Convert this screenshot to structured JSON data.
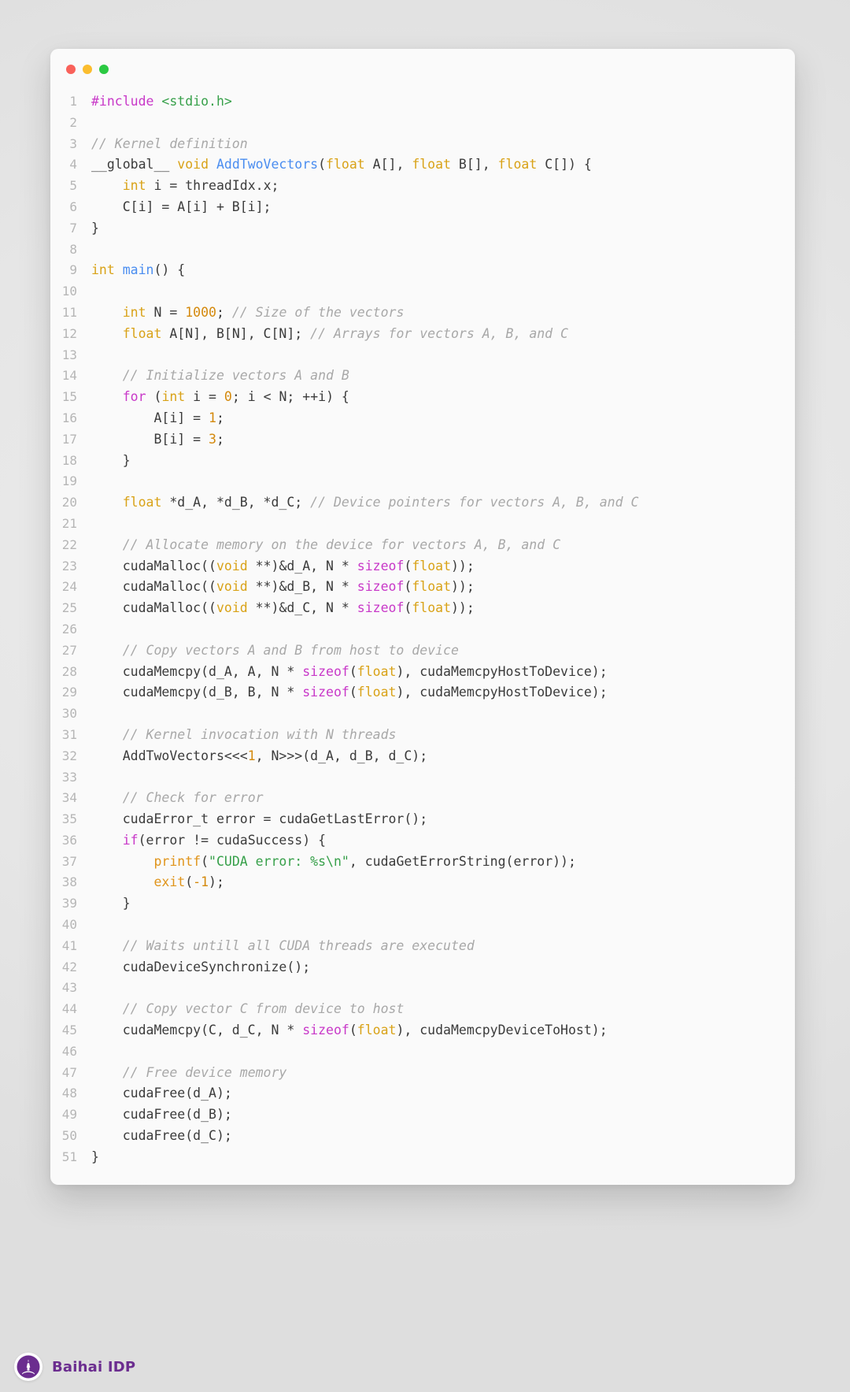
{
  "window": {
    "traffic_lights": [
      {
        "name": "close",
        "color": "#f9615a"
      },
      {
        "name": "minimize",
        "color": "#fbbd2e"
      },
      {
        "name": "maximize",
        "color": "#2bc942"
      }
    ]
  },
  "footer": {
    "brand_name": "Baihai IDP",
    "brand_color": "#6b2d8f",
    "logo_icon": "lighthouse-icon"
  },
  "theme": {
    "background": "#e6e6e6",
    "card_background": "#fafafa",
    "line_number_color": "#b6b6b6",
    "text_color": "#3b3b3b",
    "comment_color": "#a8a8a8",
    "keyword_color": "#d9a217",
    "control_keyword_color": "#c838c8",
    "function_color": "#4a8df0",
    "call_color": "#e0941a",
    "string_color": "#37a04a",
    "number_color": "#d4890c"
  },
  "code": {
    "language": "cuda-c",
    "total_lines": 51,
    "lines": [
      {
        "n": "1",
        "tokens": [
          {
            "t": "#include ",
            "c": "pre"
          },
          {
            "t": "<stdio.h>",
            "c": "str"
          }
        ]
      },
      {
        "n": "2",
        "tokens": []
      },
      {
        "n": "3",
        "tokens": [
          {
            "t": "// Kernel definition",
            "c": "cmt"
          }
        ]
      },
      {
        "n": "4",
        "tokens": [
          {
            "t": "__global__ ",
            "c": "plain"
          },
          {
            "t": "void ",
            "c": "kw"
          },
          {
            "t": "AddTwoVectors",
            "c": "fn"
          },
          {
            "t": "(",
            "c": "plain"
          },
          {
            "t": "float",
            "c": "kw"
          },
          {
            "t": " A[], ",
            "c": "plain"
          },
          {
            "t": "float",
            "c": "kw"
          },
          {
            "t": " B[], ",
            "c": "plain"
          },
          {
            "t": "float",
            "c": "kw"
          },
          {
            "t": " C[]) {",
            "c": "plain"
          }
        ]
      },
      {
        "n": "5",
        "tokens": [
          {
            "t": "    ",
            "c": "plain"
          },
          {
            "t": "int",
            "c": "kw"
          },
          {
            "t": " i = threadIdx.x;",
            "c": "plain"
          }
        ]
      },
      {
        "n": "6",
        "tokens": [
          {
            "t": "    C[i] = A[i] + B[i];",
            "c": "plain"
          }
        ]
      },
      {
        "n": "7",
        "tokens": [
          {
            "t": "}",
            "c": "plain"
          }
        ]
      },
      {
        "n": "8",
        "tokens": []
      },
      {
        "n": "9",
        "tokens": [
          {
            "t": "int ",
            "c": "kw"
          },
          {
            "t": "main",
            "c": "fn"
          },
          {
            "t": "() {",
            "c": "plain"
          }
        ]
      },
      {
        "n": "10",
        "tokens": []
      },
      {
        "n": "11",
        "tokens": [
          {
            "t": "    ",
            "c": "plain"
          },
          {
            "t": "int",
            "c": "kw"
          },
          {
            "t": " N = ",
            "c": "plain"
          },
          {
            "t": "1000",
            "c": "num"
          },
          {
            "t": "; ",
            "c": "plain"
          },
          {
            "t": "// Size of the vectors",
            "c": "cmt"
          }
        ]
      },
      {
        "n": "12",
        "tokens": [
          {
            "t": "    ",
            "c": "plain"
          },
          {
            "t": "float",
            "c": "kw"
          },
          {
            "t": " A[N], B[N], C[N]; ",
            "c": "plain"
          },
          {
            "t": "// Arrays for vectors A, B, and C",
            "c": "cmt"
          }
        ]
      },
      {
        "n": "13",
        "tokens": []
      },
      {
        "n": "14",
        "tokens": [
          {
            "t": "    ",
            "c": "plain"
          },
          {
            "t": "// Initialize vectors A and B",
            "c": "cmt"
          }
        ]
      },
      {
        "n": "15",
        "tokens": [
          {
            "t": "    ",
            "c": "plain"
          },
          {
            "t": "for",
            "c": "ctrl"
          },
          {
            "t": " (",
            "c": "plain"
          },
          {
            "t": "int",
            "c": "kw"
          },
          {
            "t": " i = ",
            "c": "plain"
          },
          {
            "t": "0",
            "c": "num"
          },
          {
            "t": "; i < N; ++i) {",
            "c": "plain"
          }
        ]
      },
      {
        "n": "16",
        "tokens": [
          {
            "t": "        A[i] = ",
            "c": "plain"
          },
          {
            "t": "1",
            "c": "num"
          },
          {
            "t": ";",
            "c": "plain"
          }
        ]
      },
      {
        "n": "17",
        "tokens": [
          {
            "t": "        B[i] = ",
            "c": "plain"
          },
          {
            "t": "3",
            "c": "num"
          },
          {
            "t": ";",
            "c": "plain"
          }
        ]
      },
      {
        "n": "18",
        "tokens": [
          {
            "t": "    }",
            "c": "plain"
          }
        ]
      },
      {
        "n": "19",
        "tokens": []
      },
      {
        "n": "20",
        "tokens": [
          {
            "t": "    ",
            "c": "plain"
          },
          {
            "t": "float",
            "c": "kw"
          },
          {
            "t": " *d_A, *d_B, *d_C; ",
            "c": "plain"
          },
          {
            "t": "// Device pointers for vectors A, B, and C",
            "c": "cmt"
          }
        ]
      },
      {
        "n": "21",
        "tokens": []
      },
      {
        "n": "22",
        "tokens": [
          {
            "t": "    ",
            "c": "plain"
          },
          {
            "t": "// Allocate memory on the device for vectors A, B, and C",
            "c": "cmt"
          }
        ]
      },
      {
        "n": "23",
        "tokens": [
          {
            "t": "    cudaMalloc((",
            "c": "plain"
          },
          {
            "t": "void",
            "c": "kw"
          },
          {
            "t": " **)&d_A, N * ",
            "c": "plain"
          },
          {
            "t": "sizeof",
            "c": "ctrl"
          },
          {
            "t": "(",
            "c": "plain"
          },
          {
            "t": "float",
            "c": "kw"
          },
          {
            "t": "));",
            "c": "plain"
          }
        ]
      },
      {
        "n": "24",
        "tokens": [
          {
            "t": "    cudaMalloc((",
            "c": "plain"
          },
          {
            "t": "void",
            "c": "kw"
          },
          {
            "t": " **)&d_B, N * ",
            "c": "plain"
          },
          {
            "t": "sizeof",
            "c": "ctrl"
          },
          {
            "t": "(",
            "c": "plain"
          },
          {
            "t": "float",
            "c": "kw"
          },
          {
            "t": "));",
            "c": "plain"
          }
        ]
      },
      {
        "n": "25",
        "tokens": [
          {
            "t": "    cudaMalloc((",
            "c": "plain"
          },
          {
            "t": "void",
            "c": "kw"
          },
          {
            "t": " **)&d_C, N * ",
            "c": "plain"
          },
          {
            "t": "sizeof",
            "c": "ctrl"
          },
          {
            "t": "(",
            "c": "plain"
          },
          {
            "t": "float",
            "c": "kw"
          },
          {
            "t": "));",
            "c": "plain"
          }
        ]
      },
      {
        "n": "26",
        "tokens": []
      },
      {
        "n": "27",
        "tokens": [
          {
            "t": "    ",
            "c": "plain"
          },
          {
            "t": "// Copy vectors A and B from host to device",
            "c": "cmt"
          }
        ]
      },
      {
        "n": "28",
        "tokens": [
          {
            "t": "    cudaMemcpy(d_A, A, N * ",
            "c": "plain"
          },
          {
            "t": "sizeof",
            "c": "ctrl"
          },
          {
            "t": "(",
            "c": "plain"
          },
          {
            "t": "float",
            "c": "kw"
          },
          {
            "t": "), cudaMemcpyHostToDevice);",
            "c": "plain"
          }
        ]
      },
      {
        "n": "29",
        "tokens": [
          {
            "t": "    cudaMemcpy(d_B, B, N * ",
            "c": "plain"
          },
          {
            "t": "sizeof",
            "c": "ctrl"
          },
          {
            "t": "(",
            "c": "plain"
          },
          {
            "t": "float",
            "c": "kw"
          },
          {
            "t": "), cudaMemcpyHostToDevice);",
            "c": "plain"
          }
        ]
      },
      {
        "n": "30",
        "tokens": []
      },
      {
        "n": "31",
        "tokens": [
          {
            "t": "    ",
            "c": "plain"
          },
          {
            "t": "// Kernel invocation with N threads",
            "c": "cmt"
          }
        ]
      },
      {
        "n": "32",
        "tokens": [
          {
            "t": "    AddTwoVectors<<<",
            "c": "plain"
          },
          {
            "t": "1",
            "c": "num"
          },
          {
            "t": ", N>>>(d_A, d_B, d_C);",
            "c": "plain"
          }
        ]
      },
      {
        "n": "33",
        "tokens": []
      },
      {
        "n": "34",
        "tokens": [
          {
            "t": "    ",
            "c": "plain"
          },
          {
            "t": "// Check for error",
            "c": "cmt"
          }
        ]
      },
      {
        "n": "35",
        "tokens": [
          {
            "t": "    cudaError_t error = cudaGetLastError();",
            "c": "plain"
          }
        ]
      },
      {
        "n": "36",
        "tokens": [
          {
            "t": "    ",
            "c": "plain"
          },
          {
            "t": "if",
            "c": "ctrl"
          },
          {
            "t": "(error != cudaSuccess) {",
            "c": "plain"
          }
        ]
      },
      {
        "n": "37",
        "tokens": [
          {
            "t": "        ",
            "c": "plain"
          },
          {
            "t": "printf",
            "c": "call"
          },
          {
            "t": "(",
            "c": "plain"
          },
          {
            "t": "\"CUDA error: %s\\n\"",
            "c": "str"
          },
          {
            "t": ", cudaGetErrorString(error));",
            "c": "plain"
          }
        ]
      },
      {
        "n": "38",
        "tokens": [
          {
            "t": "        ",
            "c": "plain"
          },
          {
            "t": "exit",
            "c": "call"
          },
          {
            "t": "(",
            "c": "plain"
          },
          {
            "t": "-1",
            "c": "num"
          },
          {
            "t": ");",
            "c": "plain"
          }
        ]
      },
      {
        "n": "39",
        "tokens": [
          {
            "t": "    }",
            "c": "plain"
          }
        ]
      },
      {
        "n": "40",
        "tokens": []
      },
      {
        "n": "41",
        "tokens": [
          {
            "t": "    ",
            "c": "plain"
          },
          {
            "t": "// Waits untill all CUDA threads are executed",
            "c": "cmt"
          }
        ]
      },
      {
        "n": "42",
        "tokens": [
          {
            "t": "    cudaDeviceSynchronize();",
            "c": "plain"
          }
        ]
      },
      {
        "n": "43",
        "tokens": []
      },
      {
        "n": "44",
        "tokens": [
          {
            "t": "    ",
            "c": "plain"
          },
          {
            "t": "// Copy vector C from device to host",
            "c": "cmt"
          }
        ]
      },
      {
        "n": "45",
        "tokens": [
          {
            "t": "    cudaMemcpy(C, d_C, N * ",
            "c": "plain"
          },
          {
            "t": "sizeof",
            "c": "ctrl"
          },
          {
            "t": "(",
            "c": "plain"
          },
          {
            "t": "float",
            "c": "kw"
          },
          {
            "t": "), cudaMemcpyDeviceToHost);",
            "c": "plain"
          }
        ]
      },
      {
        "n": "46",
        "tokens": []
      },
      {
        "n": "47",
        "tokens": [
          {
            "t": "    ",
            "c": "plain"
          },
          {
            "t": "// Free device memory",
            "c": "cmt"
          }
        ]
      },
      {
        "n": "48",
        "tokens": [
          {
            "t": "    cudaFree(d_A);",
            "c": "plain"
          }
        ]
      },
      {
        "n": "49",
        "tokens": [
          {
            "t": "    cudaFree(d_B);",
            "c": "plain"
          }
        ]
      },
      {
        "n": "50",
        "tokens": [
          {
            "t": "    cudaFree(d_C);",
            "c": "plain"
          }
        ]
      },
      {
        "n": "51",
        "tokens": [
          {
            "t": "}",
            "c": "plain"
          }
        ]
      }
    ]
  }
}
